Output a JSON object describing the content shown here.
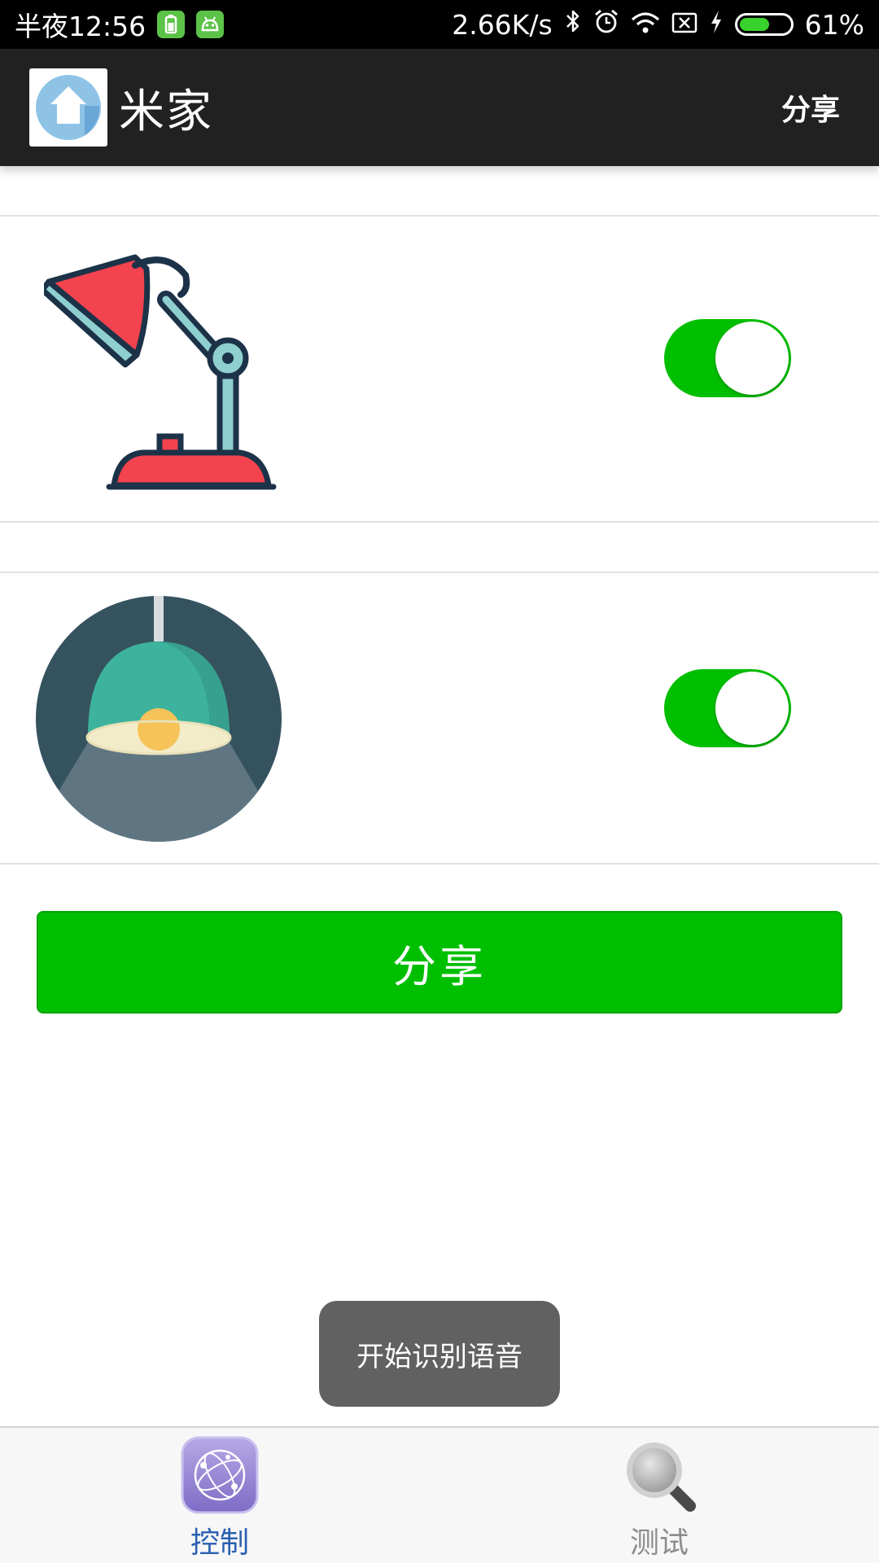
{
  "status_bar": {
    "time": "半夜12:56",
    "network_speed": "2.66K/s",
    "battery_percent": "61%",
    "battery_level": 0.61,
    "icons": [
      "battery-app-icon",
      "android-app-icon",
      "bluetooth-icon",
      "alarm-icon",
      "wifi-icon",
      "sim-off-icon",
      "charging-icon",
      "battery-icon"
    ]
  },
  "app_bar": {
    "title": "米家",
    "share_label": "分享",
    "logo_icon": "home-logo-icon"
  },
  "devices": [
    {
      "name": "desk-lamp",
      "icon": "desk-lamp-icon",
      "switch_on": true
    },
    {
      "name": "pendant-lamp",
      "icon": "pendant-lamp-icon",
      "switch_on": true
    }
  ],
  "share_button_label": "分享",
  "toast_text": "开始识别语音",
  "bottom_nav": {
    "items": [
      {
        "label": "控制",
        "icon": "control-globe-icon",
        "active": true
      },
      {
        "label": "测试",
        "icon": "magnifier-icon",
        "active": false
      }
    ]
  },
  "colors": {
    "accent_green": "#00bf00",
    "app_bar": "#212121",
    "nav_active": "#2a5fb0"
  }
}
